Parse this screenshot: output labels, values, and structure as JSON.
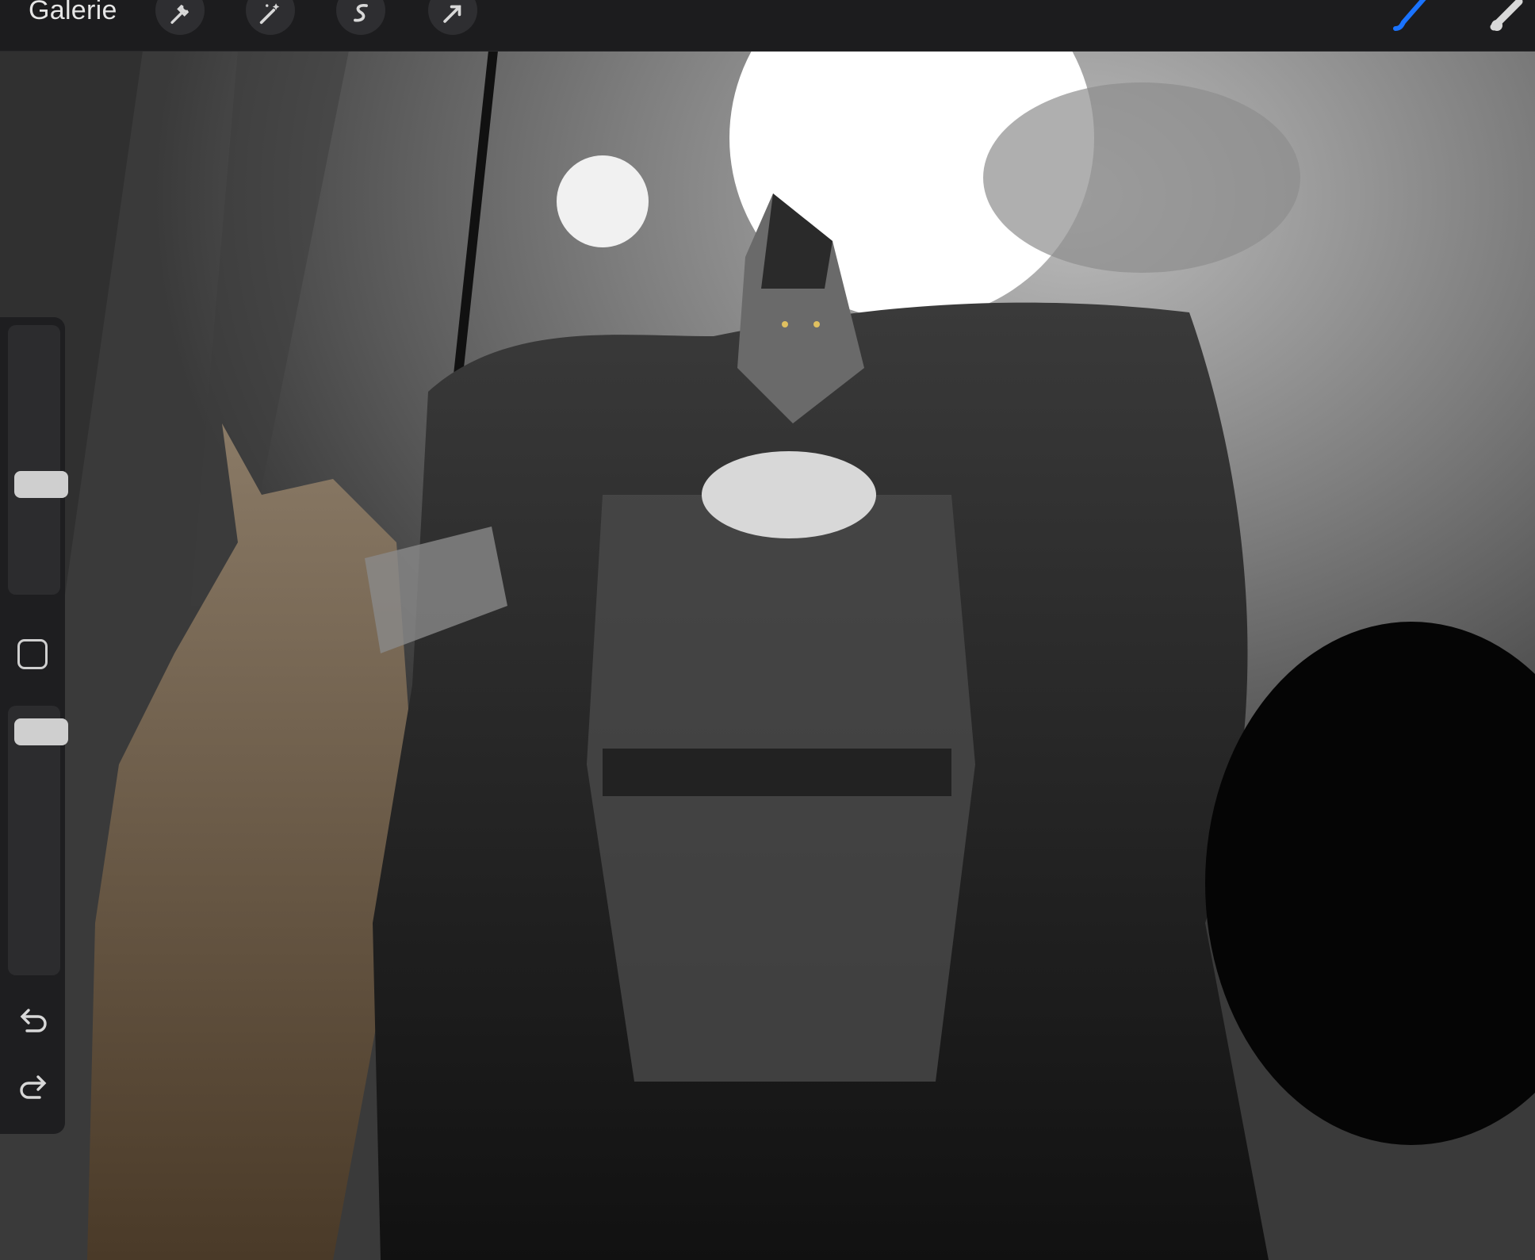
{
  "topbar": {
    "gallery_label": "Galerie",
    "left_tools": [
      {
        "name": "actions",
        "icon": "wrench-icon"
      },
      {
        "name": "adjustments",
        "icon": "magic-wand-icon"
      },
      {
        "name": "selection",
        "icon": "selection-s-icon"
      },
      {
        "name": "transform",
        "icon": "arrow-cursor-icon"
      }
    ],
    "right_tools": [
      {
        "name": "brush",
        "icon": "brush-icon",
        "active": true,
        "color": "#1a73ff"
      },
      {
        "name": "smudge",
        "icon": "smudge-icon",
        "active": false
      }
    ]
  },
  "sidebar": {
    "brush_size_slider": {
      "value": 0.4
    },
    "opacity_slider": {
      "value": 0.95
    },
    "modify_button": {
      "icon": "square-icon"
    },
    "undo": {
      "icon": "undo-icon"
    },
    "redo": {
      "icon": "redo-icon"
    }
  },
  "canvas": {
    "artwork": "digital-painting",
    "palette": {
      "background": "#7c7c7c",
      "moon": "#ffffff",
      "figure": "#1a1a1a",
      "horse": "#6e5a40"
    }
  }
}
